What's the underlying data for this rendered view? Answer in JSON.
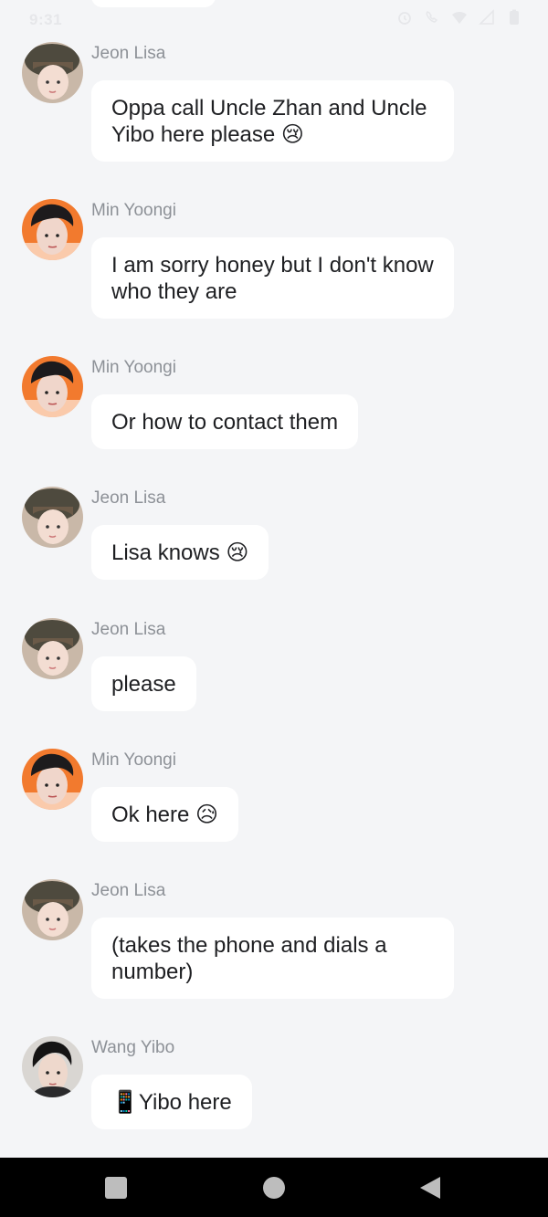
{
  "status_bar": {
    "time": "9:31",
    "icons": [
      "alarm-icon",
      "wifi-calling-icon",
      "wifi-icon",
      "signal-icon",
      "battery-icon"
    ]
  },
  "messages": [
    {
      "sender": "Jeon Lisa",
      "avatar": "lisa-avatar",
      "text": "Oppa call Uncle Zhan and Uncle Yibo here please 😢"
    },
    {
      "sender": "Min Yoongi",
      "avatar": "yoongi-avatar",
      "text": "I am sorry honey but I don't know who they are"
    },
    {
      "sender": "Min Yoongi",
      "avatar": "yoongi-avatar",
      "text": "Or how to contact them"
    },
    {
      "sender": "Jeon Lisa",
      "avatar": "lisa-avatar",
      "text": "Lisa knows 😢"
    },
    {
      "sender": "Jeon Lisa",
      "avatar": "lisa-avatar",
      "text": "please"
    },
    {
      "sender": "Min Yoongi",
      "avatar": "yoongi-avatar",
      "text": "Ok here 😥"
    },
    {
      "sender": "Jeon Lisa",
      "avatar": "lisa-avatar",
      "text": "(takes the phone and dials a number)"
    },
    {
      "sender": "Wang Yibo",
      "avatar": "yibo-avatar",
      "text": "📱Yibo here"
    }
  ],
  "nav": {
    "recents": "recents-button",
    "home": "home-button",
    "back": "back-button"
  }
}
